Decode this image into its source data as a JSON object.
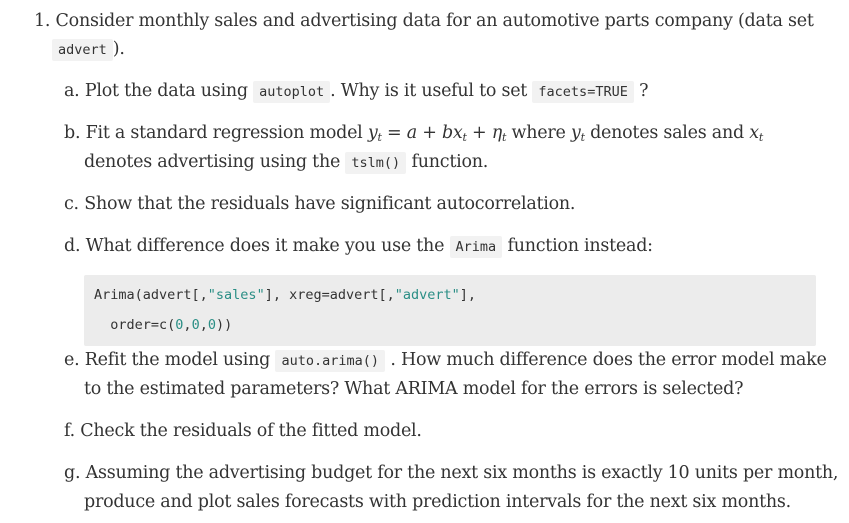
{
  "exercise": {
    "number": "1.",
    "intro_text": "Consider monthly sales and advertising data for an automotive parts company (data set",
    "intro_code": "advert",
    "intro_end": ")."
  },
  "parts": {
    "a": {
      "label": "a.",
      "text1": "Plot the data using",
      "code1": "autoplot",
      "text2": ". Why is it useful to set",
      "code2": "facets=TRUE",
      "text3": "?"
    },
    "b": {
      "label": "b.",
      "text1": "Fit a standard regression model",
      "math1_y": "y",
      "math1_sub": "t",
      "math1_eq": "= a + bx",
      "math1_sub2": "t",
      "math1_plus": "+ η",
      "math1_sub3": "t",
      "text2": "where",
      "math2_y": "y",
      "math2_sub": "t",
      "text3": "denotes sales and",
      "math3_x": "x",
      "math3_sub": "t",
      "line2_text1": "denotes advertising using the",
      "line2_code": "tslm()",
      "line2_text2": "function."
    },
    "c": {
      "label": "c.",
      "text": "Show that the residuals have significant autocorrelation."
    },
    "d": {
      "label": "d.",
      "text1": "What difference does it make you use the",
      "code": "Arima",
      "text2": "function instead:"
    },
    "code_block": {
      "l1_a": "Arima(advert[,",
      "l1_s1": "\"sales\"",
      "l1_b": "], xreg=advert[,",
      "l1_s2": "\"advert\"",
      "l1_c": "],",
      "l2_a": "  order=c(",
      "l2_n1": "0",
      "l2_c1": ",",
      "l2_n2": "0",
      "l2_c2": ",",
      "l2_n3": "0",
      "l2_b": "))"
    },
    "e": {
      "label": "e.",
      "text1": "Refit the model using",
      "code": "auto.arima()",
      "text2": ". How much difference does the error model make",
      "line2": "to the estimated parameters? What ARIMA model for the errors is selected?"
    },
    "f": {
      "label": "f.",
      "text": "Check the residuals of the fitted model."
    },
    "g": {
      "label": "g.",
      "line1": "Assuming the advertising budget for the next six months is exactly 10 units per month,",
      "line2": "produce and plot sales forecasts with prediction intervals for the next six months."
    }
  }
}
